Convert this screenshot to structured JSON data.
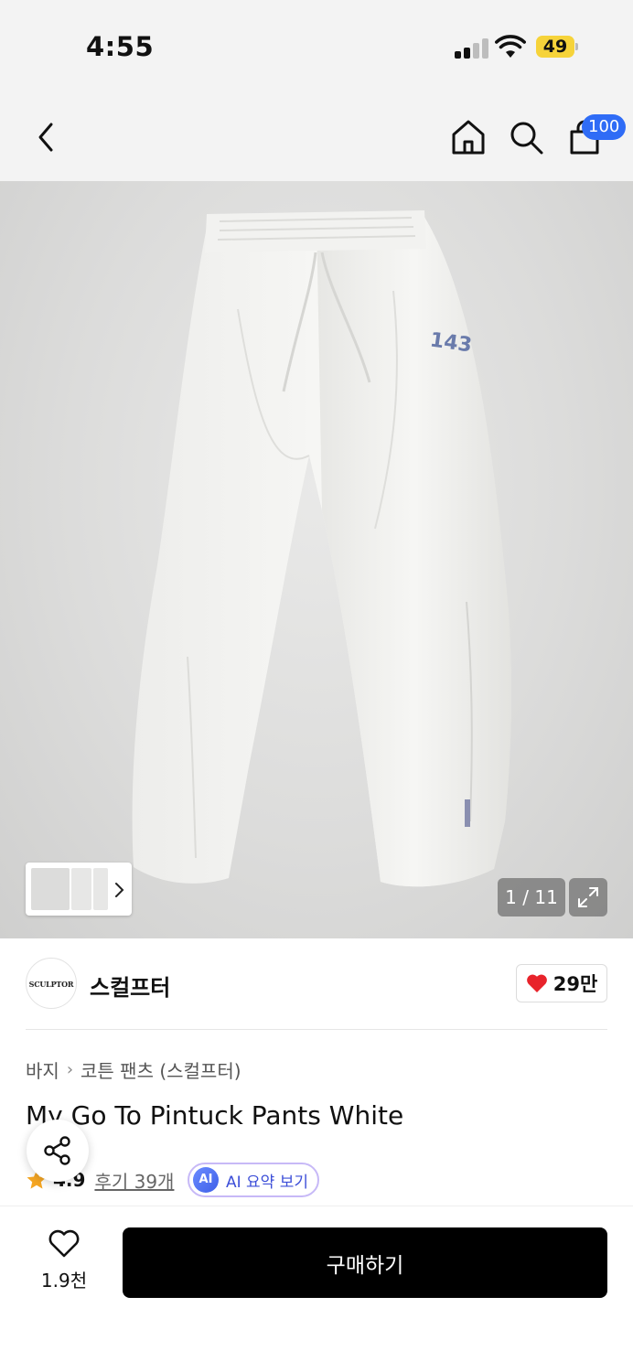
{
  "status_bar": {
    "time": "4:55",
    "battery": "49",
    "battery_color": "#f6d33a",
    "icons": [
      "signal-icon",
      "wifi-icon",
      "battery-icon"
    ]
  },
  "nav": {
    "icons": [
      "back-chevron-icon",
      "home-icon",
      "search-icon",
      "shopping-bag-icon"
    ],
    "cart_badge": "100",
    "badge_color": "#2f6cf6"
  },
  "gallery": {
    "counter": "1 / 11",
    "print_text": "143",
    "icons": [
      "thumbnail-next-icon",
      "expand-icon"
    ]
  },
  "brand": {
    "logo_text": "SCULPTOR",
    "name": "스컬프터",
    "likes": "29만",
    "heart_color": "#e8232b"
  },
  "breadcrumb": {
    "category": "바지",
    "subcategory": "코튼 팬츠 (스컬프터)"
  },
  "product": {
    "title": "My Go To Pintuck Pants White"
  },
  "rating": {
    "score": "4.9",
    "reviews": "후기 39개",
    "star_color": "#f5a623",
    "ai_badge": "AI",
    "ai_label": "AI 요약 보기"
  },
  "bottom_bar": {
    "wish_count": "1.9천",
    "buy_label": "구매하기"
  }
}
